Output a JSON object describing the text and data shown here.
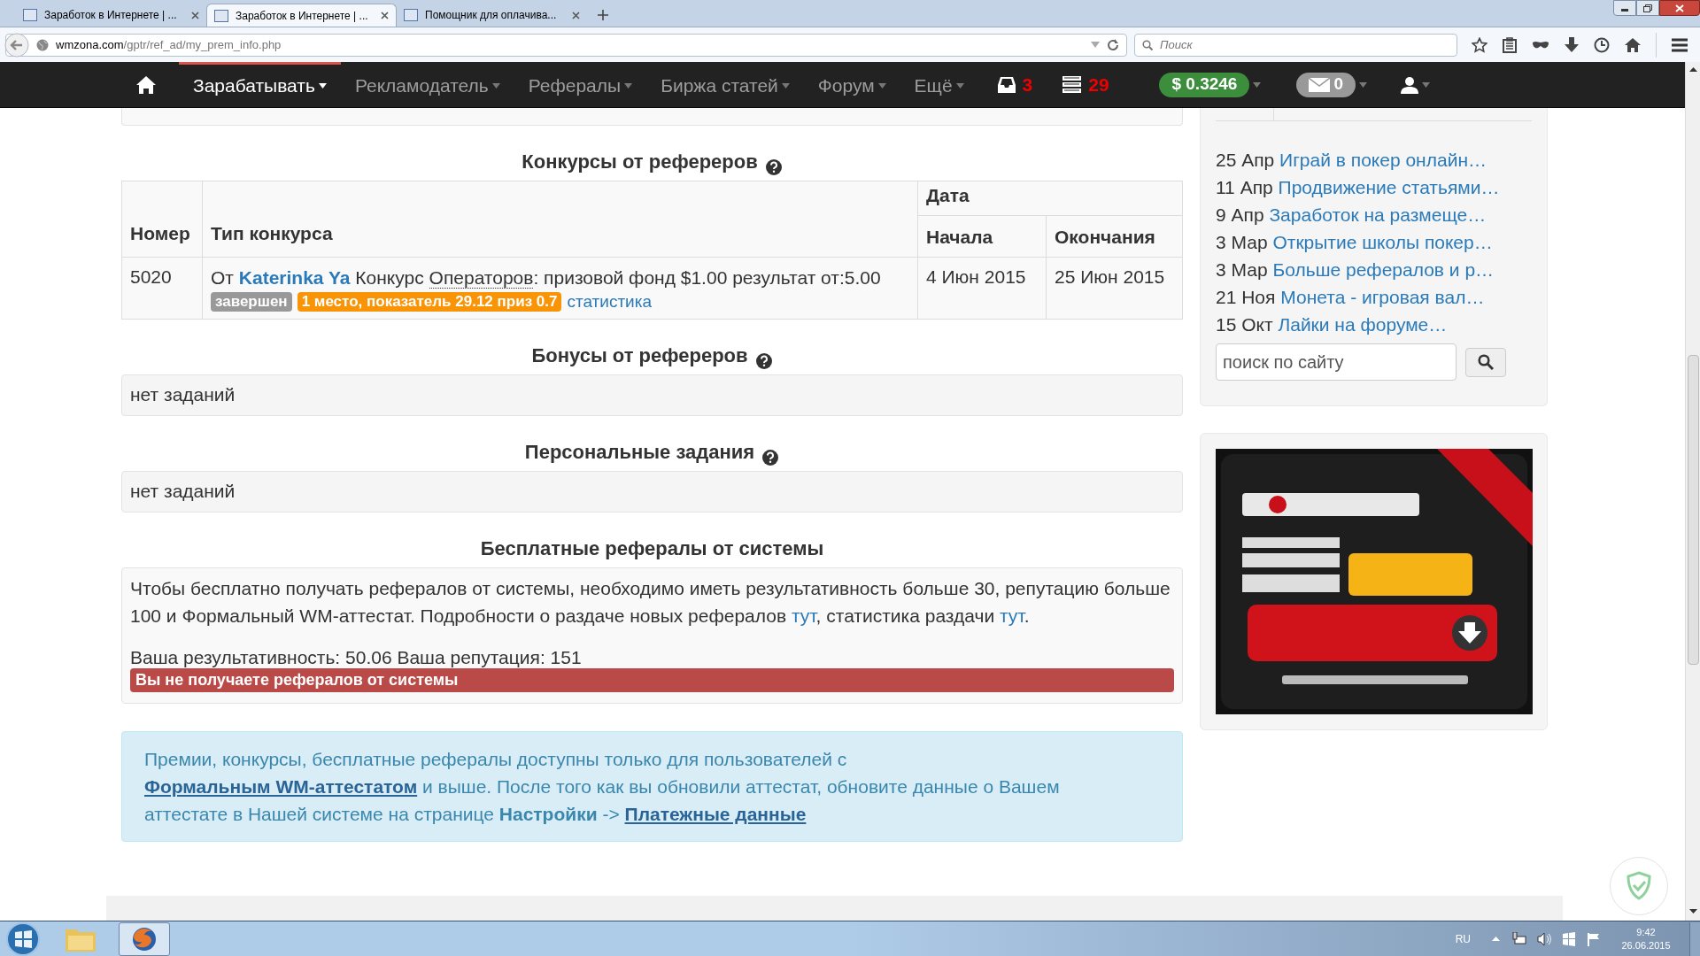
{
  "browser": {
    "tabs": [
      {
        "title": "Заработок в Интернете | ...",
        "selected": false
      },
      {
        "title": "Заработок в Интернете | ...",
        "selected": true
      },
      {
        "title": "Помощник для оплачива...",
        "selected": false
      }
    ],
    "url": {
      "host": "wmzona.com",
      "path": "/gptr/ref_ad/my_prem_info.php"
    },
    "search": {
      "placeholder": "Поиск"
    }
  },
  "nav": {
    "items": [
      {
        "label": "Зарабатывать",
        "selected": true
      },
      {
        "label": "Рекламодатель",
        "selected": false
      },
      {
        "label": "Рефералы",
        "selected": false
      },
      {
        "label": "Биржа статей",
        "selected": false
      },
      {
        "label": "Форум",
        "selected": false
      },
      {
        "label": "Ещё",
        "selected": false
      }
    ],
    "inbox_count": "3",
    "tasks_count": "29",
    "balance": "$ 0.3246",
    "messages_count": "0"
  },
  "contests": {
    "title": "Конкурсы от рефереров",
    "columns": {
      "number": "Номер",
      "type": "Тип конкурса",
      "date": "Дата",
      "start": "Начала",
      "end": "Окончания"
    },
    "rows": [
      {
        "number": "5020",
        "from": "От",
        "author": "Katerinka Ya",
        "contest": "Конкурс",
        "contest_link": "Операторов",
        "details": ": призовой фонд $1.00 результат от:5.00",
        "badges": [
          {
            "text": "завершен",
            "kind": "status"
          },
          {
            "text": "1 место, показатель 29.12 приз 0.7",
            "kind": "place"
          }
        ],
        "stats_link": "статистика",
        "start": "4 Июн 2015",
        "end": "25 Июн 2015"
      }
    ]
  },
  "bonuses": {
    "title": "Бонусы от рефереров",
    "empty": "нет заданий"
  },
  "personal": {
    "title": "Персональные задания",
    "empty": "нет заданий"
  },
  "free_referrals": {
    "title": "Бесплатные рефералы от системы",
    "paragraph": [
      {
        "kind": "text",
        "text": "Чтобы бесплатно получать рефералов от системы, необходимо иметь результативность больше 30, репутацию больше 100 и Формальный WM-аттестат. Подробности о раздаче новых рефералов "
      },
      {
        "kind": "link",
        "text": "тут"
      },
      {
        "kind": "text",
        "text": ", статистика раздачи "
      },
      {
        "kind": "link",
        "text": "тут"
      },
      {
        "kind": "text",
        "text": "."
      }
    ],
    "stats": "Ваша результативность: 50.06 Ваша репутация: 151",
    "alert": "Вы не получаете рефералов от системы"
  },
  "info": [
    {
      "kind": "text",
      "text": "Премии, конкурсы, бесплатные рефералы доступны только для пользователей с "
    },
    {
      "kind": "link",
      "text": "Формальным WM-аттестатом"
    },
    {
      "kind": "text",
      "text": " и выше. После того как вы обновили аттестат, обновите данные о Вашем аттестате в Нашей системе на странице **Настройки** -> "
    },
    {
      "kind": "link",
      "text": "Платежные данные"
    }
  ],
  "sidebar": {
    "news": [
      {
        "date": "25 Апр",
        "title": "Играй в покер онлайн…"
      },
      {
        "date": "11 Апр",
        "title": "Продвижение статьями…"
      },
      {
        "date": "9 Апр",
        "title": "Заработок на размеще…"
      },
      {
        "date": "3 Мар",
        "title": "Открытие школы покер…"
      },
      {
        "date": "3 Мар",
        "title": "Больше рефералов и р…"
      },
      {
        "date": "21 Ноя",
        "title": "Монета - игровая вал…"
      },
      {
        "date": "15 Окт",
        "title": "Лайки на форуме…"
      }
    ],
    "search": {
      "placeholder": "поиск по сайту"
    }
  },
  "taskbar": {
    "language": "RU",
    "time": "9:42",
    "date": "26.06.2015"
  }
}
